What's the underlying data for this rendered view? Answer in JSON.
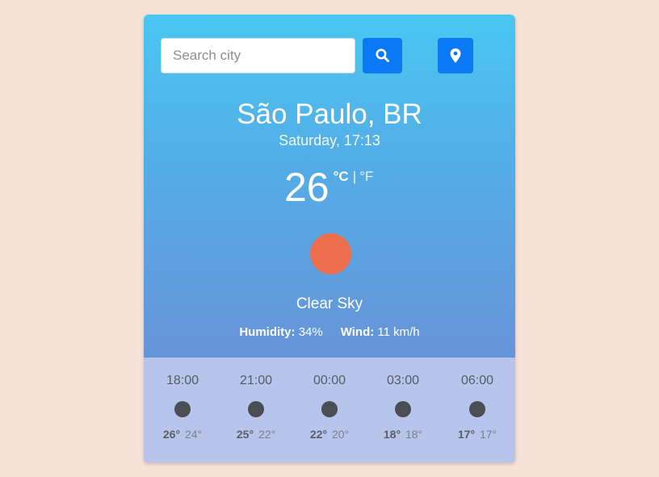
{
  "search": {
    "placeholder": "Search city",
    "value": ""
  },
  "icons": {
    "search_button": "search-icon",
    "location_button": "map-pin-icon"
  },
  "location": {
    "city": "São Paulo, BR",
    "datetime": "Saturday, 17:13"
  },
  "current": {
    "temperature": "26",
    "unit_celsius": "°C",
    "unit_separator": "|",
    "unit_fahrenheit": "°F",
    "icon": "sun-icon",
    "description": "Clear Sky",
    "humidity_label": "Humidity:",
    "humidity_value": "34%",
    "wind_label": "Wind:",
    "wind_value": "11 km/h"
  },
  "forecast": [
    {
      "time": "18:00",
      "max": "26°",
      "min": "24°"
    },
    {
      "time": "21:00",
      "max": "25°",
      "min": "22°"
    },
    {
      "time": "00:00",
      "max": "22°",
      "min": "20°"
    },
    {
      "time": "03:00",
      "max": "18°",
      "min": "18°"
    },
    {
      "time": "06:00",
      "max": "17°",
      "min": "17°"
    }
  ],
  "colors": {
    "page_background": "#f7e1d9",
    "gradient_top": "#49c7f2",
    "gradient_bottom": "#6794d9",
    "button_blue": "#0b79f5",
    "sun_orange": "#ec6e4c",
    "forecast_background": "#b7c4ec",
    "forecast_icon": "#4a4d52"
  }
}
